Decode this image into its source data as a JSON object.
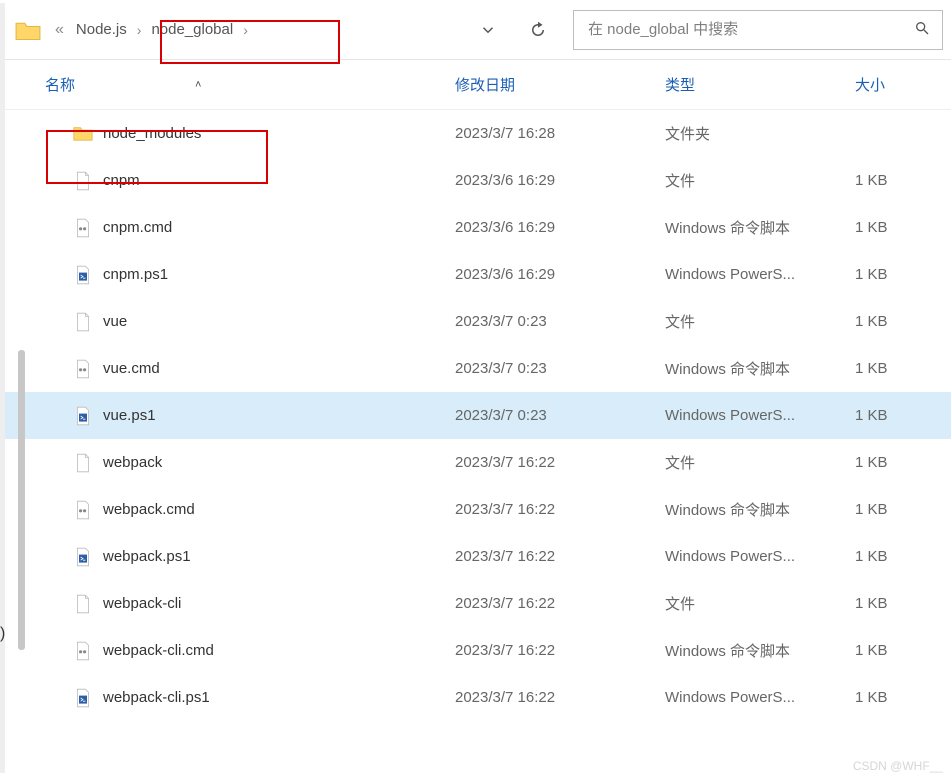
{
  "breadcrumb": {
    "root_icon": "folder",
    "chevrons_label": "«",
    "parts": [
      "Node.js",
      "node_global"
    ]
  },
  "search": {
    "placeholder": "在 node_global 中搜索"
  },
  "columns": {
    "name": "名称",
    "date": "修改日期",
    "type": "类型",
    "size": "大小"
  },
  "files": [
    {
      "icon": "folder",
      "name": "node_modules",
      "date": "2023/3/7 16:28",
      "type": "文件夹",
      "size": ""
    },
    {
      "icon": "file",
      "name": "cnpm",
      "date": "2023/3/6 16:29",
      "type": "文件",
      "size": "1 KB"
    },
    {
      "icon": "cmd",
      "name": "cnpm.cmd",
      "date": "2023/3/6 16:29",
      "type": "Windows 命令脚本",
      "size": "1 KB"
    },
    {
      "icon": "ps1",
      "name": "cnpm.ps1",
      "date": "2023/3/6 16:29",
      "type": "Windows PowerS...",
      "size": "1 KB"
    },
    {
      "icon": "file",
      "name": "vue",
      "date": "2023/3/7 0:23",
      "type": "文件",
      "size": "1 KB"
    },
    {
      "icon": "cmd",
      "name": "vue.cmd",
      "date": "2023/3/7 0:23",
      "type": "Windows 命令脚本",
      "size": "1 KB"
    },
    {
      "icon": "ps1",
      "name": "vue.ps1",
      "date": "2023/3/7 0:23",
      "type": "Windows PowerS...",
      "size": "1 KB",
      "selected": true
    },
    {
      "icon": "file",
      "name": "webpack",
      "date": "2023/3/7 16:22",
      "type": "文件",
      "size": "1 KB"
    },
    {
      "icon": "cmd",
      "name": "webpack.cmd",
      "date": "2023/3/7 16:22",
      "type": "Windows 命令脚本",
      "size": "1 KB"
    },
    {
      "icon": "ps1",
      "name": "webpack.ps1",
      "date": "2023/3/7 16:22",
      "type": "Windows PowerS...",
      "size": "1 KB"
    },
    {
      "icon": "file",
      "name": "webpack-cli",
      "date": "2023/3/7 16:22",
      "type": "文件",
      "size": "1 KB"
    },
    {
      "icon": "cmd",
      "name": "webpack-cli.cmd",
      "date": "2023/3/7 16:22",
      "type": "Windows 命令脚本",
      "size": "1 KB"
    },
    {
      "icon": "ps1",
      "name": "webpack-cli.ps1",
      "date": "2023/3/7 16:22",
      "type": "Windows PowerS...",
      "size": "1 KB"
    }
  ],
  "watermark": "CSDN @WHF__"
}
